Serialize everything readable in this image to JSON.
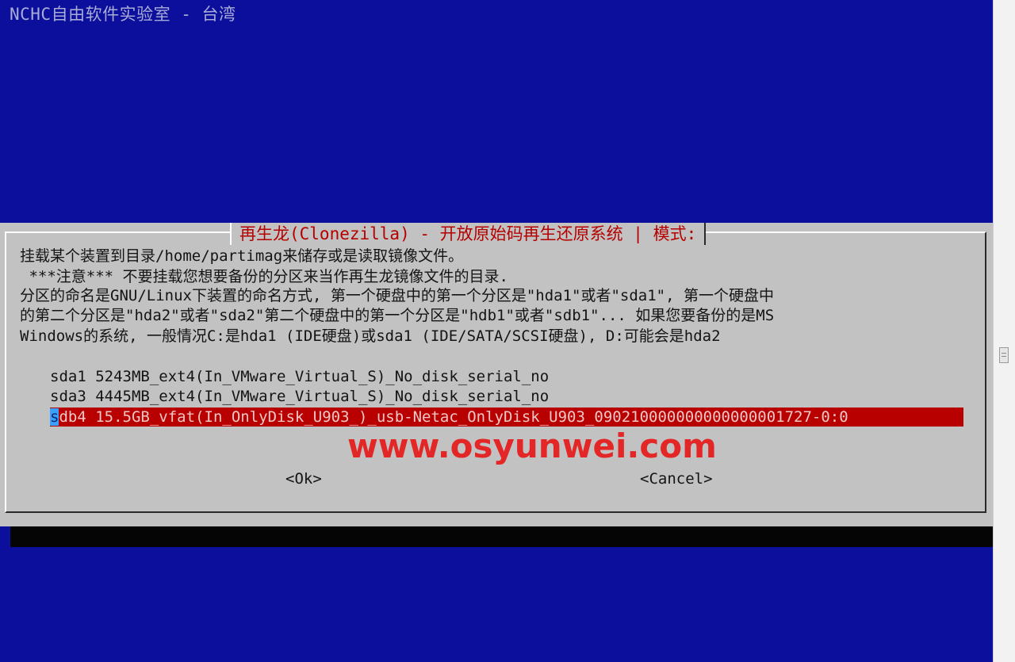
{
  "backtitle": "NCHC自由软件实验室 - 台湾",
  "dialog": {
    "title": "再生龙(Clonezilla) - 开放原始码再生还原系统 | 模式:",
    "description_lines": [
      "挂载某个装置到目录/home/partimag来储存或是读取镜像文件。",
      " ***注意*** 不要挂载您想要备份的分区来当作再生龙镜像文件的目录.",
      "分区的命名是GNU/Linux下装置的命名方式, 第一个硬盘中的第一个分区是\"hda1\"或者\"sda1\", 第一个硬盘中",
      "的第二个分区是\"hda2\"或者\"sda2\"第二个硬盘中的第一个分区是\"hdb1\"或者\"sdb1\"... 如果您要备份的是MS",
      "Windows的系统, 一般情况C:是hda1 (IDE硬盘)或sda1 (IDE/SATA/SCSI硬盘), D:可能会是hda2"
    ],
    "items": [
      {
        "name": "sda1",
        "desc": "5243MB_ext4(In_VMware_Virtual_S)_No_disk_serial_no"
      },
      {
        "name": "sda3",
        "desc": "4445MB_ext4(In_VMware_Virtual_S)_No_disk_serial_no"
      },
      {
        "name": "sdb4",
        "desc": "15.5GB_vfat(In_OnlyDisk_U903_)_usb-Netac_OnlyDisk_U903_090210000000000000001727-0:0"
      }
    ],
    "selected_index": 2,
    "ok_label": "<Ok>",
    "cancel_label": "<Cancel>"
  },
  "watermark": "www.osyunwei.com",
  "colors": {
    "background": "#0b0f9c",
    "dialog": "#c2c2c2",
    "title_text": "#b50000",
    "selected_bg": "#b80000",
    "watermark": "#e32626"
  }
}
